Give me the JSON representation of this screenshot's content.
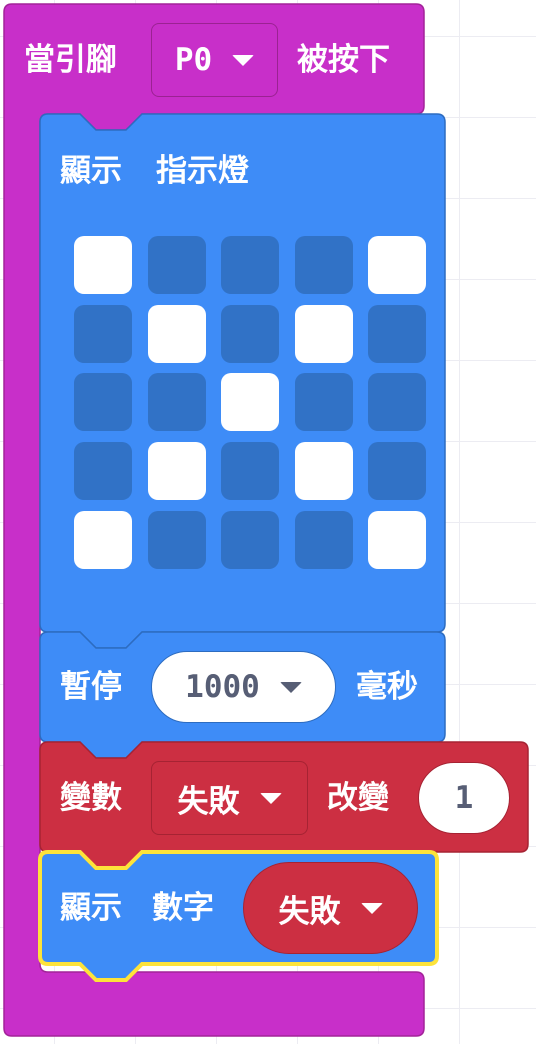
{
  "colors": {
    "event_block": "#c82fc9",
    "basic_block": "#3e8cf7",
    "variable_block": "#cc2f42",
    "selected_outline": "#fde33a",
    "led_off": "#3172c6",
    "led_on": "#ffffff"
  },
  "event_block": {
    "prefix": "當引腳",
    "pin": "P0",
    "suffix": "被按下"
  },
  "show_leds": {
    "label_1": "顯示",
    "label_2": "指示燈",
    "grid": [
      [
        1,
        0,
        0,
        0,
        1
      ],
      [
        0,
        1,
        0,
        1,
        0
      ],
      [
        0,
        0,
        1,
        0,
        0
      ],
      [
        0,
        1,
        0,
        1,
        0
      ],
      [
        1,
        0,
        0,
        0,
        1
      ]
    ]
  },
  "pause": {
    "label": "暫停",
    "value": "1000",
    "unit": "毫秒"
  },
  "change_var": {
    "label": "變數",
    "variable": "失敗",
    "action": "改變",
    "amount": "1"
  },
  "show_number": {
    "label_1": "顯示",
    "label_2": "數字",
    "variable": "失敗"
  },
  "icons": {
    "dropdown": "caret-down-icon"
  }
}
